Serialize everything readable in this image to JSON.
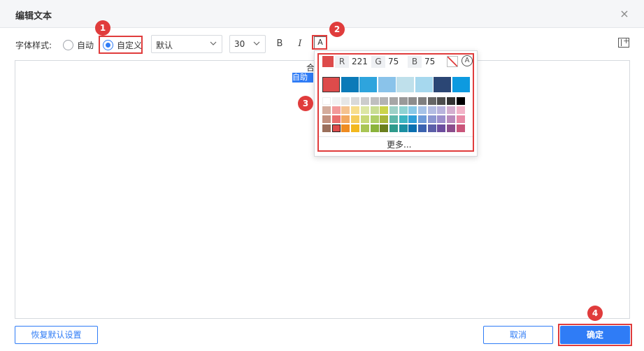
{
  "dialog": {
    "title": "编辑文本",
    "close_icon": "×"
  },
  "toolbar": {
    "label": "字体样式:",
    "radio_auto": "自动",
    "radio_custom": "自定义",
    "font_family": "默认",
    "font_size": "30",
    "bold_icon": "B",
    "italic_icon": "I",
    "font_color_icon": "A"
  },
  "editor": {
    "line1": "合",
    "selected_text": "自助"
  },
  "color_picker": {
    "current_color": "#dd4b4b",
    "r_label": "R",
    "r_value": "221",
    "g_label": "G",
    "g_value": "75",
    "b_label": "B",
    "b_value": "75",
    "auto_icon": "A",
    "theme_colors": [
      "#dd4b4b",
      "#0b7ab8",
      "#2ea4dd",
      "#8ac3ea",
      "#bfe0eb",
      "#a6d8ee",
      "#2b4674",
      "#0d9ae0"
    ],
    "selected_theme_index": 0,
    "grid": [
      [
        "#ffffff",
        "#f2f2f2",
        "#e6e6e6",
        "#d9d9d9",
        "#cccccc",
        "#bfbfbf",
        "#b3b3b3",
        "#a6a6a6",
        "#999999",
        "#8c8c8c",
        "#7f7f7f",
        "#666666",
        "#4d4d4d",
        "#333333",
        "#000000"
      ],
      [
        "#d4ac9c",
        "#f29a9a",
        "#f5c28f",
        "#f7dd8c",
        "#dce6a5",
        "#c9dd92",
        "#cbd44a",
        "#9ed1c8",
        "#8fd3d3",
        "#88c9e8",
        "#a6c3e8",
        "#b4bde3",
        "#b9b3dd",
        "#d4aecf",
        "#f2b3c8"
      ],
      [
        "#c2917f",
        "#e96e6e",
        "#f2a860",
        "#f5cd5c",
        "#c8d97a",
        "#b0cf67",
        "#a8b63a",
        "#5fb8ab",
        "#3db5c2",
        "#2f9fd9",
        "#6f9cd9",
        "#8d97d1",
        "#9c8ecb",
        "#b889bb",
        "#e88aa6"
      ],
      [
        "#9b6f5c",
        "#dd4b4b",
        "#ee8c22",
        "#f2b81f",
        "#a9c555",
        "#8bb33c",
        "#6b7f1e",
        "#2f9a8c",
        "#1b8fa2",
        "#0b6fb0",
        "#3c63b0",
        "#5c5fa8",
        "#6c4d9e",
        "#8b4d8c",
        "#c9557a"
      ]
    ],
    "selected_grid": [
      3,
      1
    ],
    "more_label": "更多..."
  },
  "footer": {
    "restore_label": "恢复默认设置",
    "cancel_label": "取消",
    "confirm_label": "确定"
  },
  "annotations": {
    "badge1": "1",
    "badge2": "2",
    "badge3": "3",
    "badge4": "4",
    "highlight_color": "#e03c3c"
  }
}
